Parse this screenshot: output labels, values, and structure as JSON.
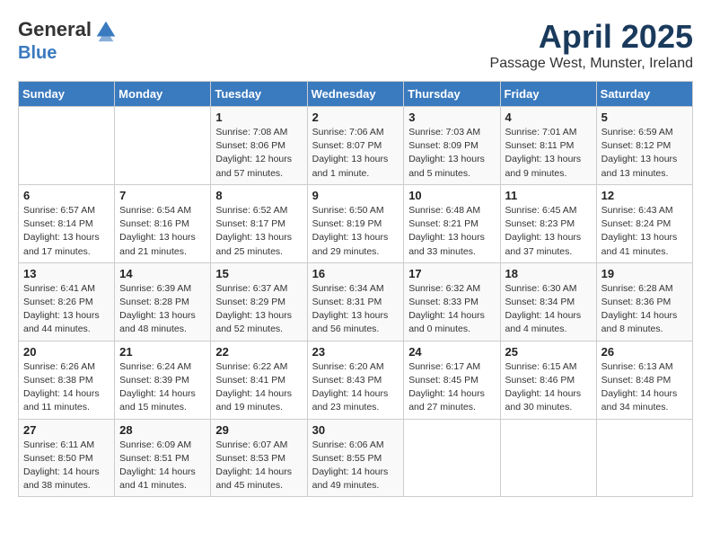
{
  "header": {
    "logo_general": "General",
    "logo_blue": "Blue",
    "month": "April 2025",
    "location": "Passage West, Munster, Ireland"
  },
  "days_of_week": [
    "Sunday",
    "Monday",
    "Tuesday",
    "Wednesday",
    "Thursday",
    "Friday",
    "Saturday"
  ],
  "weeks": [
    [
      {
        "day": "",
        "sunrise": "",
        "sunset": "",
        "daylight": ""
      },
      {
        "day": "",
        "sunrise": "",
        "sunset": "",
        "daylight": ""
      },
      {
        "day": "1",
        "sunrise": "Sunrise: 7:08 AM",
        "sunset": "Sunset: 8:06 PM",
        "daylight": "Daylight: 12 hours and 57 minutes."
      },
      {
        "day": "2",
        "sunrise": "Sunrise: 7:06 AM",
        "sunset": "Sunset: 8:07 PM",
        "daylight": "Daylight: 13 hours and 1 minute."
      },
      {
        "day": "3",
        "sunrise": "Sunrise: 7:03 AM",
        "sunset": "Sunset: 8:09 PM",
        "daylight": "Daylight: 13 hours and 5 minutes."
      },
      {
        "day": "4",
        "sunrise": "Sunrise: 7:01 AM",
        "sunset": "Sunset: 8:11 PM",
        "daylight": "Daylight: 13 hours and 9 minutes."
      },
      {
        "day": "5",
        "sunrise": "Sunrise: 6:59 AM",
        "sunset": "Sunset: 8:12 PM",
        "daylight": "Daylight: 13 hours and 13 minutes."
      }
    ],
    [
      {
        "day": "6",
        "sunrise": "Sunrise: 6:57 AM",
        "sunset": "Sunset: 8:14 PM",
        "daylight": "Daylight: 13 hours and 17 minutes."
      },
      {
        "day": "7",
        "sunrise": "Sunrise: 6:54 AM",
        "sunset": "Sunset: 8:16 PM",
        "daylight": "Daylight: 13 hours and 21 minutes."
      },
      {
        "day": "8",
        "sunrise": "Sunrise: 6:52 AM",
        "sunset": "Sunset: 8:17 PM",
        "daylight": "Daylight: 13 hours and 25 minutes."
      },
      {
        "day": "9",
        "sunrise": "Sunrise: 6:50 AM",
        "sunset": "Sunset: 8:19 PM",
        "daylight": "Daylight: 13 hours and 29 minutes."
      },
      {
        "day": "10",
        "sunrise": "Sunrise: 6:48 AM",
        "sunset": "Sunset: 8:21 PM",
        "daylight": "Daylight: 13 hours and 33 minutes."
      },
      {
        "day": "11",
        "sunrise": "Sunrise: 6:45 AM",
        "sunset": "Sunset: 8:23 PM",
        "daylight": "Daylight: 13 hours and 37 minutes."
      },
      {
        "day": "12",
        "sunrise": "Sunrise: 6:43 AM",
        "sunset": "Sunset: 8:24 PM",
        "daylight": "Daylight: 13 hours and 41 minutes."
      }
    ],
    [
      {
        "day": "13",
        "sunrise": "Sunrise: 6:41 AM",
        "sunset": "Sunset: 8:26 PM",
        "daylight": "Daylight: 13 hours and 44 minutes."
      },
      {
        "day": "14",
        "sunrise": "Sunrise: 6:39 AM",
        "sunset": "Sunset: 8:28 PM",
        "daylight": "Daylight: 13 hours and 48 minutes."
      },
      {
        "day": "15",
        "sunrise": "Sunrise: 6:37 AM",
        "sunset": "Sunset: 8:29 PM",
        "daylight": "Daylight: 13 hours and 52 minutes."
      },
      {
        "day": "16",
        "sunrise": "Sunrise: 6:34 AM",
        "sunset": "Sunset: 8:31 PM",
        "daylight": "Daylight: 13 hours and 56 minutes."
      },
      {
        "day": "17",
        "sunrise": "Sunrise: 6:32 AM",
        "sunset": "Sunset: 8:33 PM",
        "daylight": "Daylight: 14 hours and 0 minutes."
      },
      {
        "day": "18",
        "sunrise": "Sunrise: 6:30 AM",
        "sunset": "Sunset: 8:34 PM",
        "daylight": "Daylight: 14 hours and 4 minutes."
      },
      {
        "day": "19",
        "sunrise": "Sunrise: 6:28 AM",
        "sunset": "Sunset: 8:36 PM",
        "daylight": "Daylight: 14 hours and 8 minutes."
      }
    ],
    [
      {
        "day": "20",
        "sunrise": "Sunrise: 6:26 AM",
        "sunset": "Sunset: 8:38 PM",
        "daylight": "Daylight: 14 hours and 11 minutes."
      },
      {
        "day": "21",
        "sunrise": "Sunrise: 6:24 AM",
        "sunset": "Sunset: 8:39 PM",
        "daylight": "Daylight: 14 hours and 15 minutes."
      },
      {
        "day": "22",
        "sunrise": "Sunrise: 6:22 AM",
        "sunset": "Sunset: 8:41 PM",
        "daylight": "Daylight: 14 hours and 19 minutes."
      },
      {
        "day": "23",
        "sunrise": "Sunrise: 6:20 AM",
        "sunset": "Sunset: 8:43 PM",
        "daylight": "Daylight: 14 hours and 23 minutes."
      },
      {
        "day": "24",
        "sunrise": "Sunrise: 6:17 AM",
        "sunset": "Sunset: 8:45 PM",
        "daylight": "Daylight: 14 hours and 27 minutes."
      },
      {
        "day": "25",
        "sunrise": "Sunrise: 6:15 AM",
        "sunset": "Sunset: 8:46 PM",
        "daylight": "Daylight: 14 hours and 30 minutes."
      },
      {
        "day": "26",
        "sunrise": "Sunrise: 6:13 AM",
        "sunset": "Sunset: 8:48 PM",
        "daylight": "Daylight: 14 hours and 34 minutes."
      }
    ],
    [
      {
        "day": "27",
        "sunrise": "Sunrise: 6:11 AM",
        "sunset": "Sunset: 8:50 PM",
        "daylight": "Daylight: 14 hours and 38 minutes."
      },
      {
        "day": "28",
        "sunrise": "Sunrise: 6:09 AM",
        "sunset": "Sunset: 8:51 PM",
        "daylight": "Daylight: 14 hours and 41 minutes."
      },
      {
        "day": "29",
        "sunrise": "Sunrise: 6:07 AM",
        "sunset": "Sunset: 8:53 PM",
        "daylight": "Daylight: 14 hours and 45 minutes."
      },
      {
        "day": "30",
        "sunrise": "Sunrise: 6:06 AM",
        "sunset": "Sunset: 8:55 PM",
        "daylight": "Daylight: 14 hours and 49 minutes."
      },
      {
        "day": "",
        "sunrise": "",
        "sunset": "",
        "daylight": ""
      },
      {
        "day": "",
        "sunrise": "",
        "sunset": "",
        "daylight": ""
      },
      {
        "day": "",
        "sunrise": "",
        "sunset": "",
        "daylight": ""
      }
    ]
  ]
}
